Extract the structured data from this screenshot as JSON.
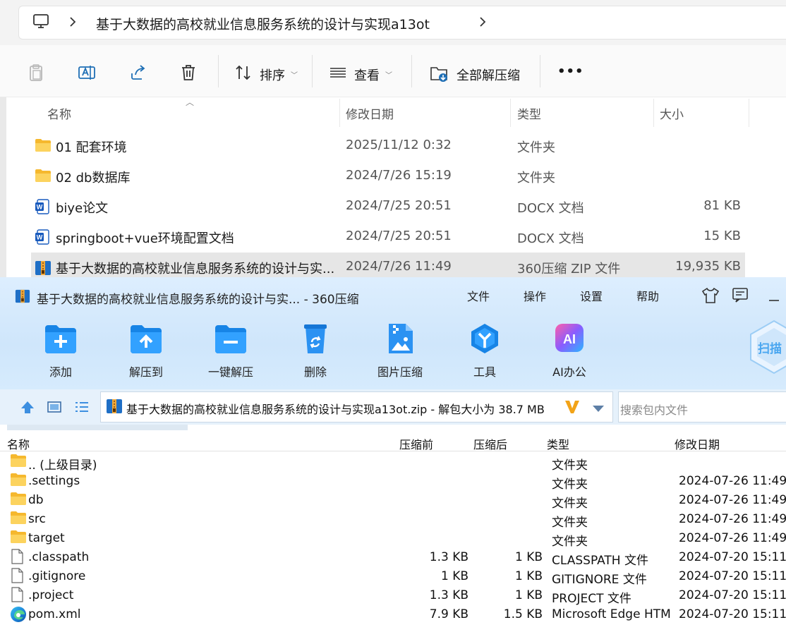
{
  "explorer": {
    "breadcrumb": "基于大数据的高校就业信息服务系统的设计与实现a13ot",
    "toolbar": {
      "sort": "排序",
      "view": "查看",
      "extract_all": "全部解压缩",
      "more": "•••"
    },
    "columns": {
      "name": "名称",
      "date": "修改日期",
      "type": "类型",
      "size": "大小"
    },
    "rows": [
      {
        "name": "01 配套环境",
        "date": "2025/11/12 0:32",
        "type": "文件夹",
        "size": "",
        "icon": "folder-icon"
      },
      {
        "name": "02 db数据库",
        "date": "2024/7/26 15:19",
        "type": "文件夹",
        "size": "",
        "icon": "folder-icon"
      },
      {
        "name": "biye论文",
        "date": "2024/7/25 20:51",
        "type": "DOCX 文档",
        "size": "81 KB",
        "icon": "word-icon"
      },
      {
        "name": "springboot+vue环境配置文档",
        "date": "2024/7/25 20:51",
        "type": "DOCX 文档",
        "size": "15 KB",
        "icon": "word-icon"
      },
      {
        "name": "基于大数据的高校就业信息服务系统的设计与实...",
        "date": "2024/7/26 11:49",
        "type": "360压缩 ZIP 文件",
        "size": "19,935 KB",
        "icon": "zip-icon"
      }
    ]
  },
  "zip": {
    "title": "基于大数据的高校就业信息服务系统的设计与实... - 360压缩",
    "menu": [
      "文件",
      "操作",
      "设置",
      "帮助"
    ],
    "tools": [
      "添加",
      "解压到",
      "一键解压",
      "删除",
      "图片压缩",
      "工具",
      "AI办公"
    ],
    "scan_badge": "扫描",
    "ai_icon_text": "AI",
    "path": "基于大数据的高校就业信息服务系统的设计与实现a13ot.zip - 解包大小为 38.7 MB",
    "search_placeholder": "搜索包内文件",
    "columns": {
      "name": "名称",
      "before": "压缩前",
      "after": "压缩后",
      "type": "类型",
      "date": "修改日期"
    },
    "rows": [
      {
        "name": ".. (上级目录)",
        "before": "",
        "after": "",
        "type": "文件夹",
        "date": "",
        "icon": "folder-icon"
      },
      {
        "name": ".settings",
        "before": "",
        "after": "",
        "type": "文件夹",
        "date": "2024-07-26 11:49",
        "icon": "folder-icon"
      },
      {
        "name": "db",
        "before": "",
        "after": "",
        "type": "文件夹",
        "date": "2024-07-26 11:49",
        "icon": "folder-icon"
      },
      {
        "name": "src",
        "before": "",
        "after": "",
        "type": "文件夹",
        "date": "2024-07-26 11:49",
        "icon": "folder-icon"
      },
      {
        "name": "target",
        "before": "",
        "after": "",
        "type": "文件夹",
        "date": "2024-07-26 11:49",
        "icon": "folder-icon"
      },
      {
        "name": ".classpath",
        "before": "1.3 KB",
        "after": "1 KB",
        "type": "CLASSPATH 文件",
        "date": "2024-07-20 15:11",
        "icon": "file-icon"
      },
      {
        "name": ".gitignore",
        "before": "1 KB",
        "after": "1 KB",
        "type": "GITIGNORE 文件",
        "date": "2024-07-20 15:11",
        "icon": "file-icon"
      },
      {
        "name": ".project",
        "before": "1.3 KB",
        "after": "1 KB",
        "type": "PROJECT 文件",
        "date": "2024-07-20 15:11",
        "icon": "file-icon"
      },
      {
        "name": "pom.xml",
        "before": "7.9 KB",
        "after": "1.5 KB",
        "type": "Microsoft Edge HTML Document",
        "date": "2024-07-20 15:11",
        "icon": "edge-icon"
      }
    ]
  }
}
